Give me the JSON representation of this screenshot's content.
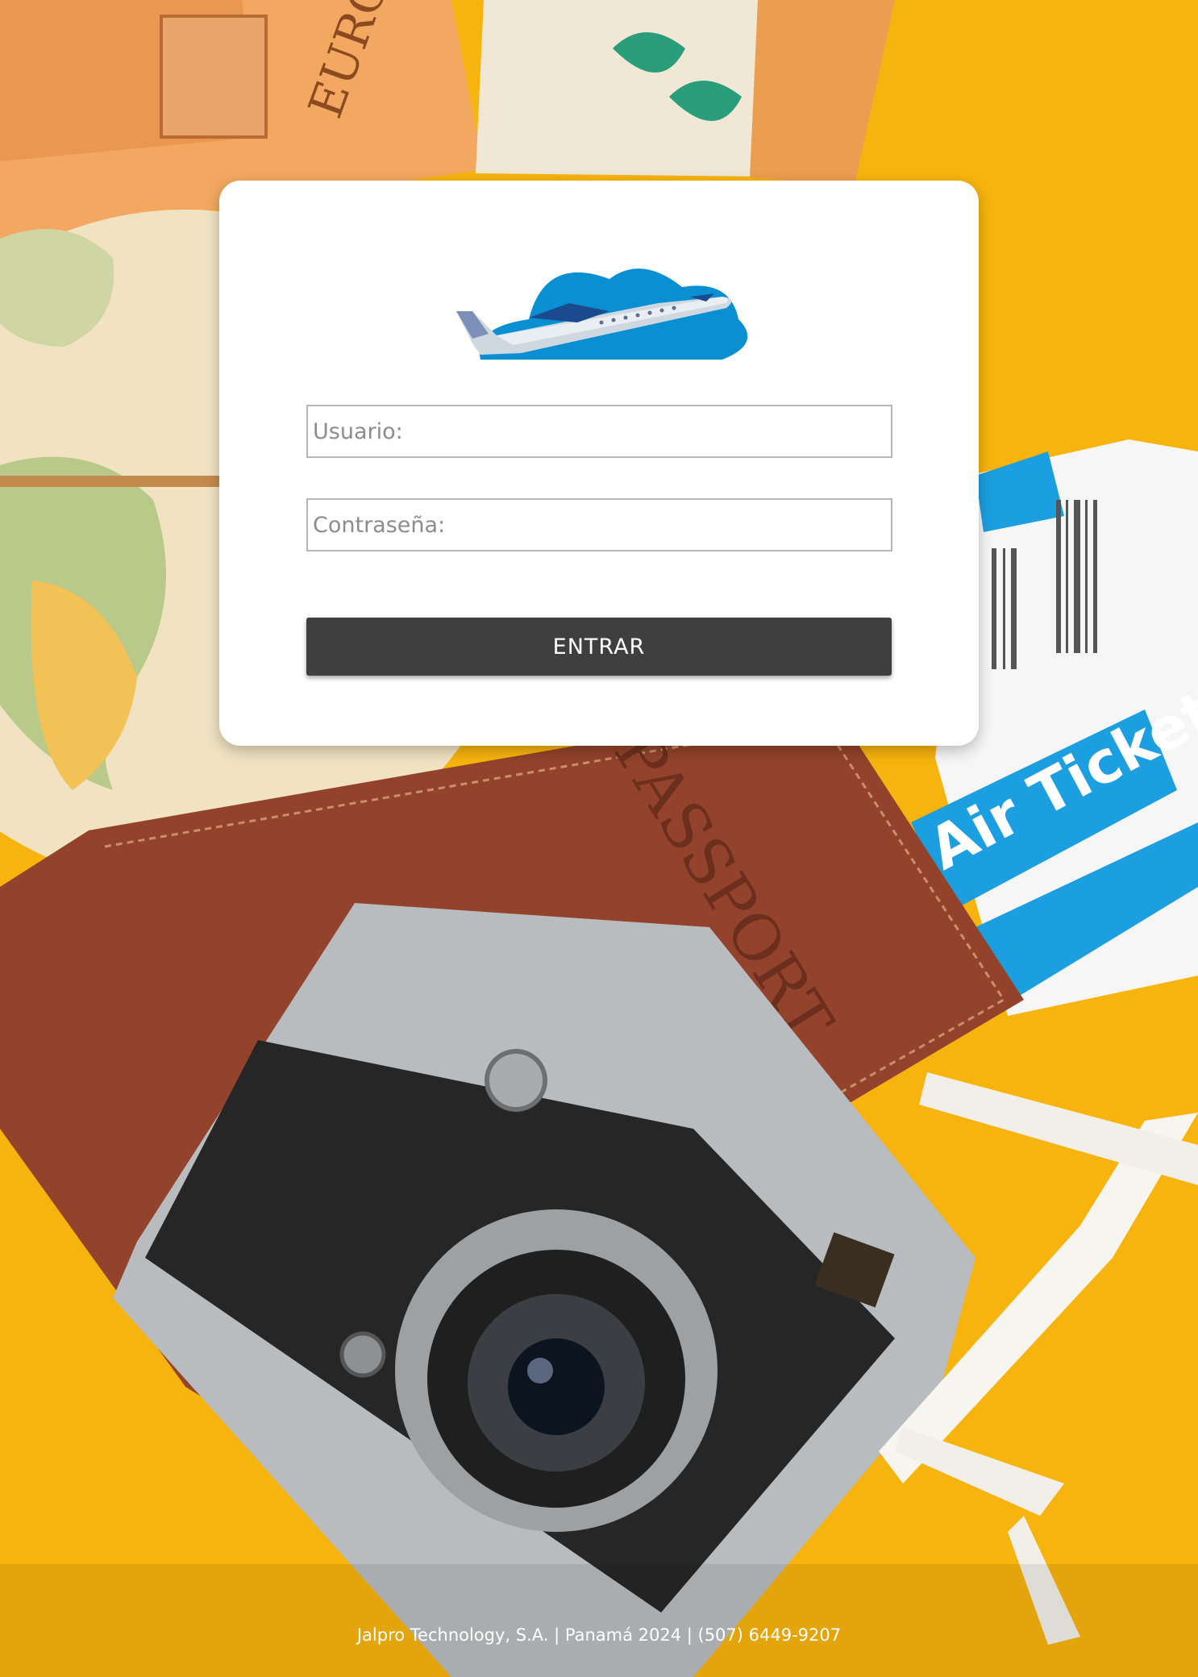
{
  "login": {
    "username_placeholder": "Usuario:",
    "password_placeholder": "Contraseña:",
    "submit_label": "ENTRAR"
  },
  "background": {
    "passport_text": "PASSPORT",
    "ticket_text": "Air Ticket",
    "banknote_text": "EURO"
  },
  "footer": {
    "text": "Jalpro Technology, S.A. | Panamá 2024 | (507) 6449-9207"
  },
  "colors": {
    "background": "#f8b40e",
    "button": "#3f3f3f",
    "logo_cloud": "#0a8fd2"
  }
}
